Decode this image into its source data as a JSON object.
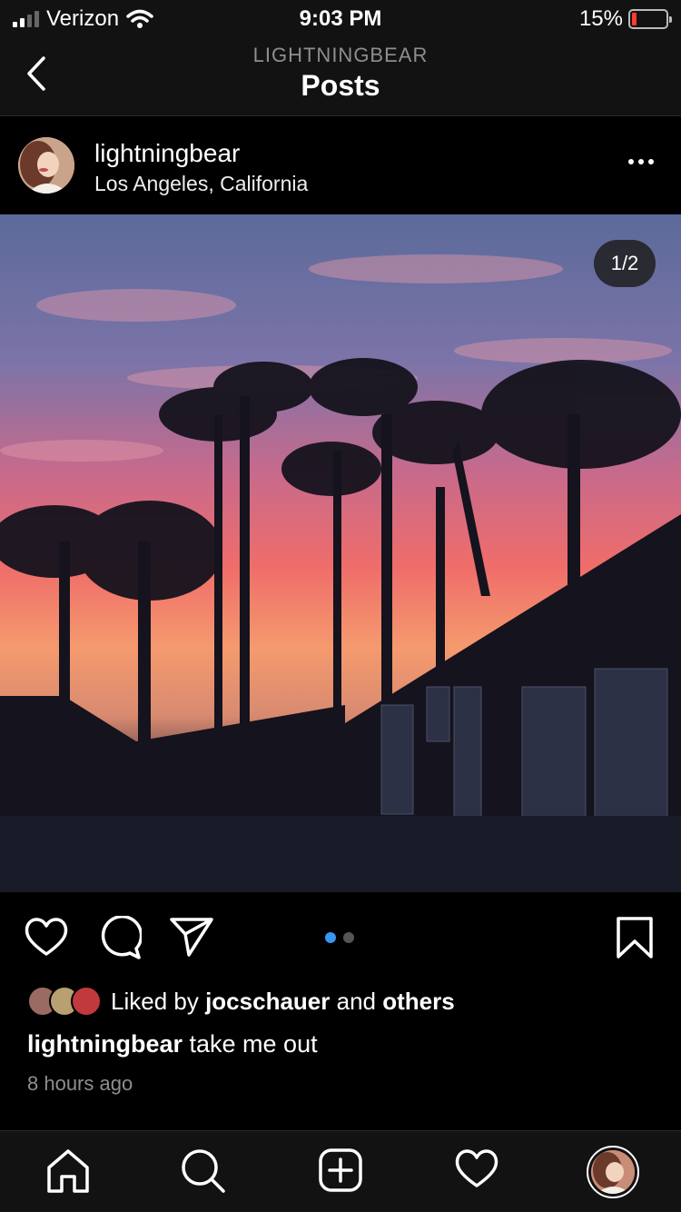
{
  "status": {
    "carrier": "Verizon",
    "time": "9:03 PM",
    "battery": "15%"
  },
  "nav": {
    "subtitle": "LIGHTNINGBEAR",
    "title": "Posts"
  },
  "post": {
    "username": "lightningbear",
    "location": "Los Angeles, California",
    "counter": "1/2",
    "liked_prefix": "Liked by",
    "liked_user": "jocschauer",
    "liked_and": "and",
    "liked_others": "others",
    "caption_user": "lightningbear",
    "caption_text": "take me out",
    "time": "8 hours ago"
  },
  "icons": {
    "back": "chevron-left-icon",
    "more": "more-icon",
    "like": "heart-icon",
    "comment": "comment-icon",
    "share": "send-icon",
    "save": "bookmark-icon",
    "home": "home-icon",
    "search": "search-icon",
    "new_post": "plus-square-icon",
    "activity": "heart-icon"
  },
  "colors": {
    "accent": "#3897f0",
    "background": "#000000",
    "bar": "#121212",
    "battery_low": "#ff3b30"
  }
}
